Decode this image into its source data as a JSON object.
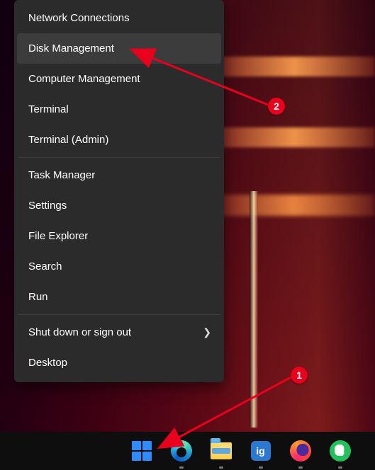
{
  "menu": {
    "items": [
      {
        "label": "Network Connections",
        "highlight": false
      },
      {
        "label": "Disk Management",
        "highlight": true
      },
      {
        "label": "Computer Management",
        "highlight": false
      },
      {
        "label": "Terminal",
        "highlight": false
      },
      {
        "label": "Terminal (Admin)",
        "highlight": false
      }
    ],
    "items2": [
      {
        "label": "Task Manager"
      },
      {
        "label": "Settings"
      },
      {
        "label": "File Explorer"
      },
      {
        "label": "Search"
      },
      {
        "label": "Run"
      }
    ],
    "items3": [
      {
        "label": "Shut down or sign out",
        "submenu": true
      },
      {
        "label": "Desktop"
      }
    ]
  },
  "taskbar": {
    "apps": [
      {
        "name": "start"
      },
      {
        "name": "edge"
      },
      {
        "name": "file-explorer"
      },
      {
        "name": "ig"
      },
      {
        "name": "firefox"
      },
      {
        "name": "evernote"
      }
    ],
    "ig_text": "ig"
  },
  "annotations": {
    "badge1": "1",
    "badge2": "2"
  }
}
